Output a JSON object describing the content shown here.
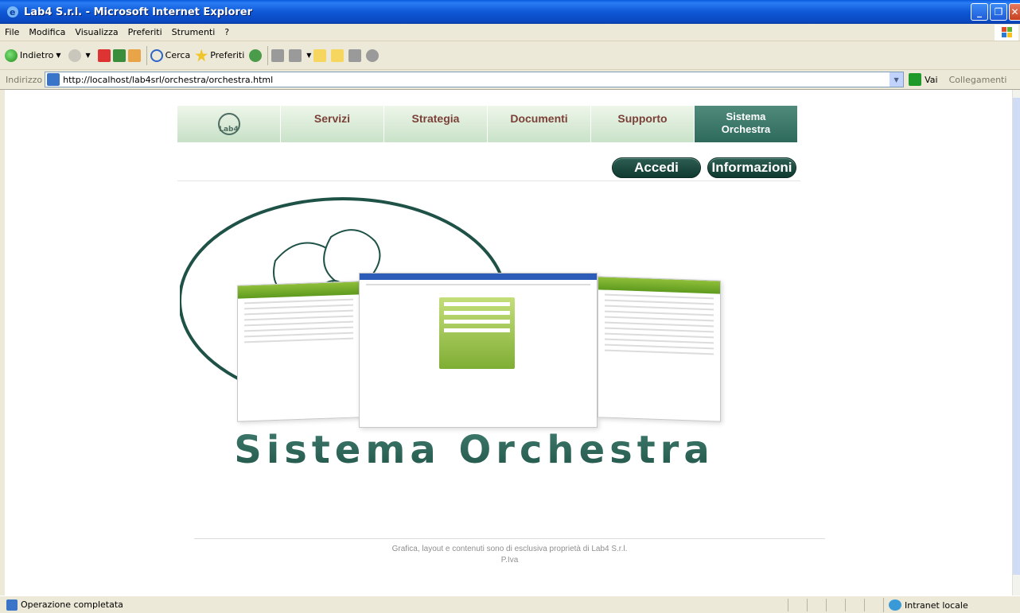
{
  "window": {
    "title": "Lab4 S.r.l. - Microsoft Internet Explorer"
  },
  "menu": [
    "File",
    "Modifica",
    "Visualizza",
    "Preferiti",
    "Strumenti",
    "?"
  ],
  "toolbar": {
    "back_label": "Indietro",
    "search_label": "Cerca",
    "favorites_label": "Preferiti"
  },
  "address": {
    "label": "Indirizzo",
    "url": "http://localhost/lab4srl/orchestra/orchestra.html",
    "go_label": "Vai",
    "links_label": "Collegamenti"
  },
  "site": {
    "logo_text": "Lab4",
    "nav": [
      {
        "label": "Servizi"
      },
      {
        "label": "Strategia"
      },
      {
        "label": "Documenti"
      },
      {
        "label": "Supporto"
      },
      {
        "label": "Sistema Orchestra",
        "line1": "Sistema",
        "line2": "Orchestra",
        "active": true
      }
    ],
    "buttons": {
      "login": "Accedi",
      "info": "Informazioni"
    },
    "hero_title": "Sistema Orchestra",
    "footer": {
      "line1": "Grafica, layout e contenuti sono di esclusiva proprietà di Lab4 S.r.l.",
      "line2": "P.Iva"
    }
  },
  "status": {
    "text": "Operazione completata",
    "zone": "Intranet locale"
  },
  "colors": {
    "nav_text": "#7b4138",
    "nav_active": "#2e6a5c",
    "brand_dark": "#215548"
  }
}
